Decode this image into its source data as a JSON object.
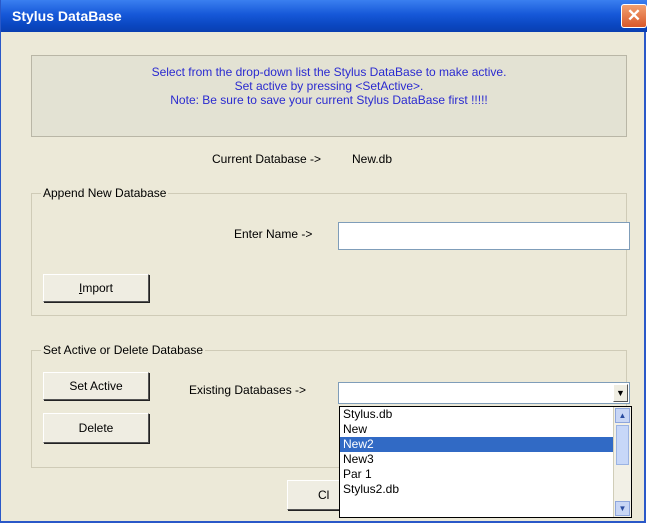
{
  "window": {
    "title": "Stylus DataBase",
    "close_glyph": "✕"
  },
  "info": {
    "line1": "Select from the drop-down list the Stylus DataBase to make active.",
    "line2": "Set active by pressing <SetActive>.",
    "line3": "Note: Be sure to save your current Stylus DataBase first !!!!!"
  },
  "current": {
    "label": "Current Database ->",
    "value": "New.db"
  },
  "append_group": {
    "legend": "Append New Database",
    "name_label": "Enter Name ->",
    "name_value": "",
    "import_label_u": "I",
    "import_label_rest": "mport"
  },
  "active_group": {
    "legend": "Set Active or Delete Database",
    "set_active_label": "Set Active",
    "delete_label": "Delete",
    "existing_label": "Existing Databases ->",
    "selected_value": ""
  },
  "dropdown_list": {
    "items": [
      "Stylus.db",
      "New",
      "New2",
      "New3",
      "Par 1",
      "Stylus2.db"
    ],
    "selected_index": 2
  },
  "close_button_partial": "Cl",
  "icons": {
    "dropdown": "chevron-down-icon",
    "scroll_up": "scroll-up-icon",
    "scroll_down": "scroll-down-icon"
  }
}
